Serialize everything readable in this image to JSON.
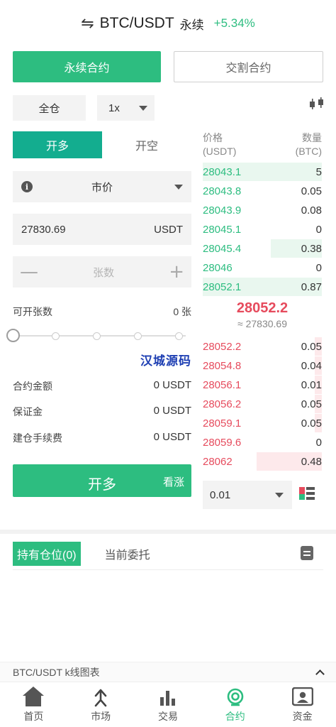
{
  "header": {
    "swap_icon": "swap-arrows-icon",
    "pair": "BTC/USDT",
    "contract_type": "永续",
    "change": "+5.34%"
  },
  "contract_tabs": {
    "perpetual": "永续合约",
    "delivery": "交割合约"
  },
  "mode": {
    "margin_mode": "全仓",
    "leverage": "1x"
  },
  "order": {
    "open_long": "开多",
    "open_short": "开空",
    "order_type": "市价",
    "price": "27830.69",
    "price_unit": "USDT",
    "qty_placeholder": "张数",
    "minus": "—",
    "plus": "+",
    "available_label": "可开张数",
    "available_value": "0 张",
    "watermark": "汉城源码",
    "contract_amount_label": "合约金额",
    "contract_amount_value": "0 USDT",
    "margin_label": "保证金",
    "margin_value": "0 USDT",
    "fee_label": "建仓手续费",
    "fee_value": "0 USDT",
    "submit_label": "开多",
    "submit_sub": "看涨",
    "slider_percent": 0
  },
  "orderbook": {
    "price_header": "价格",
    "price_unit": "(USDT)",
    "qty_header": "数量",
    "qty_unit": "(BTC)",
    "bids": [
      {
        "price": "28043.1",
        "qty": "5",
        "depth": 1.0
      },
      {
        "price": "28043.8",
        "qty": "0.05",
        "depth": 0
      },
      {
        "price": "28043.9",
        "qty": "0.08",
        "depth": 0
      },
      {
        "price": "28045.1",
        "qty": "0",
        "depth": 0
      },
      {
        "price": "28045.4",
        "qty": "0.38",
        "depth": 0.43
      },
      {
        "price": "28046",
        "qty": "0",
        "depth": 0
      },
      {
        "price": "28052.1",
        "qty": "0.87",
        "depth": 1.0
      }
    ],
    "last_price": "28052.2",
    "index_price": "≈ 27830.69",
    "asks": [
      {
        "price": "28052.2",
        "qty": "0.05",
        "depth": 0.06
      },
      {
        "price": "28054.8",
        "qty": "0.04",
        "depth": 0.06
      },
      {
        "price": "28056.1",
        "qty": "0.01",
        "depth": 0.06
      },
      {
        "price": "28056.2",
        "qty": "0.05",
        "depth": 0.06
      },
      {
        "price": "28059.1",
        "qty": "0.05",
        "depth": 0.06
      },
      {
        "price": "28059.6",
        "qty": "0",
        "depth": 0
      },
      {
        "price": "28062",
        "qty": "0.48",
        "depth": 0.55
      }
    ],
    "depth_precision": "0.01"
  },
  "positions": {
    "holding_tab": "持有仓位(0)",
    "orders_tab": "当前委托"
  },
  "kline_bar": {
    "label": "BTC/USDT k线图表"
  },
  "tabbar": [
    {
      "label": "首页",
      "icon": "home-icon"
    },
    {
      "label": "市场",
      "icon": "market-icon"
    },
    {
      "label": "交易",
      "icon": "trade-chart-icon"
    },
    {
      "label": "合约",
      "icon": "contract-icon"
    },
    {
      "label": "资金",
      "icon": "wallet-icon"
    }
  ],
  "colors": {
    "green": "#2dbd80",
    "teal": "#13ad8f",
    "red": "#e64b5d"
  }
}
